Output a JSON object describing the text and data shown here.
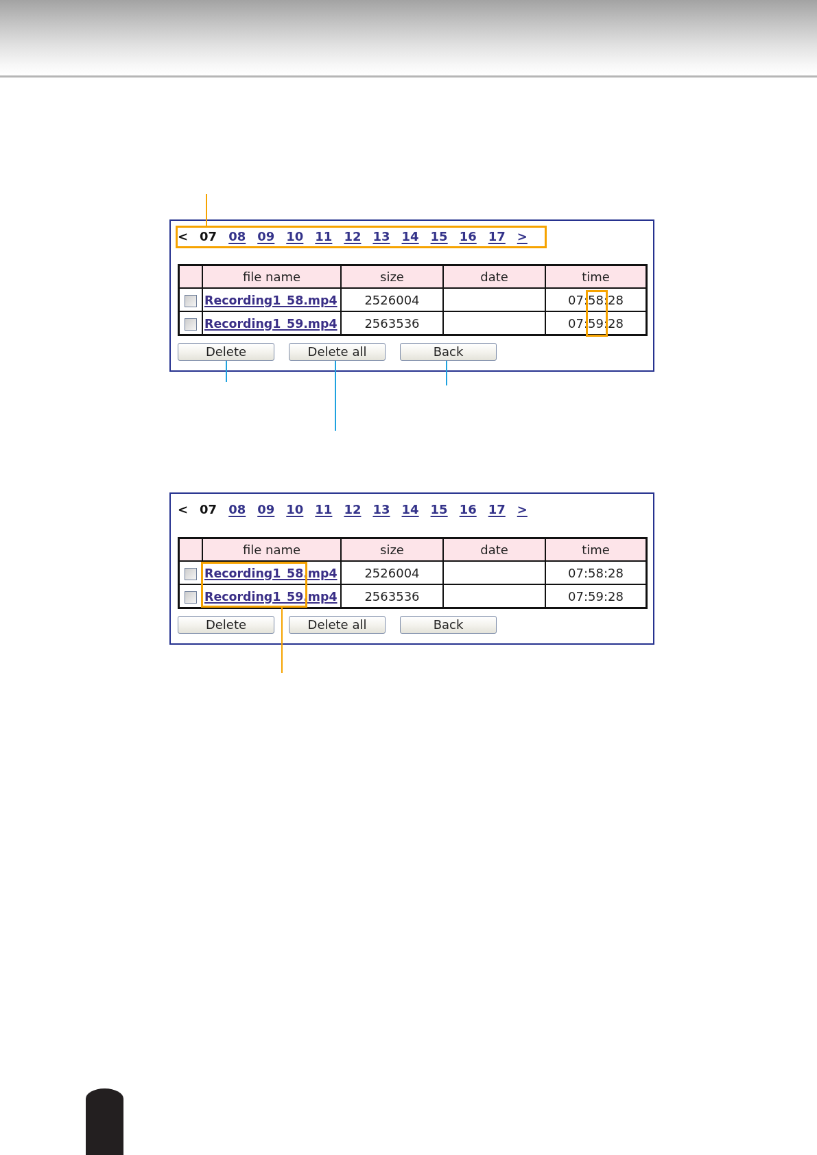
{
  "panels": [
    {
      "pagination": {
        "prev": {
          "label": "<",
          "disabled": true
        },
        "pages": [
          {
            "label": "07",
            "selected": true
          },
          {
            "label": "08",
            "selected": false
          },
          {
            "label": "09",
            "selected": false
          },
          {
            "label": "10",
            "selected": false
          },
          {
            "label": "11",
            "selected": false
          },
          {
            "label": "12",
            "selected": false
          },
          {
            "label": "13",
            "selected": false
          },
          {
            "label": "14",
            "selected": false
          },
          {
            "label": "15",
            "selected": false
          },
          {
            "label": "16",
            "selected": false
          },
          {
            "label": "17",
            "selected": false
          }
        ],
        "next": {
          "label": ">",
          "disabled": false
        }
      },
      "table": {
        "columns": [
          "file name",
          "size",
          "date",
          "time"
        ],
        "rows": [
          {
            "checked": false,
            "file_name": "Recording1_58.mp4",
            "size": "2526004",
            "time": "07:58:28"
          },
          {
            "checked": false,
            "file_name": "Recording1_59.mp4",
            "size": "2563536",
            "time": "07:59:28"
          }
        ]
      },
      "buttons": [
        {
          "label": "Delete"
        },
        {
          "label": "Delete all"
        },
        {
          "label": "Back"
        }
      ]
    },
    {
      "pagination": {
        "prev": {
          "label": "<",
          "disabled": true
        },
        "pages": [
          {
            "label": "07",
            "selected": true
          },
          {
            "label": "08",
            "selected": false
          },
          {
            "label": "09",
            "selected": false
          },
          {
            "label": "10",
            "selected": false
          },
          {
            "label": "11",
            "selected": false
          },
          {
            "label": "12",
            "selected": false
          },
          {
            "label": "13",
            "selected": false
          },
          {
            "label": "14",
            "selected": false
          },
          {
            "label": "15",
            "selected": false
          },
          {
            "label": "16",
            "selected": false
          },
          {
            "label": "17",
            "selected": false
          }
        ],
        "next": {
          "label": ">",
          "disabled": false
        }
      },
      "table": {
        "columns": [
          "file name",
          "size",
          "date",
          "time"
        ],
        "rows": [
          {
            "checked": false,
            "file_name": "Recording1_58.mp4",
            "size": "2526004",
            "time": "07:58:28"
          },
          {
            "checked": false,
            "file_name": "Recording1_59.mp4",
            "size": "2563536",
            "time": "07:59:28"
          }
        ]
      },
      "buttons": [
        {
          "label": "Delete"
        },
        {
          "label": "Delete all"
        },
        {
          "label": "Back"
        }
      ]
    }
  ]
}
